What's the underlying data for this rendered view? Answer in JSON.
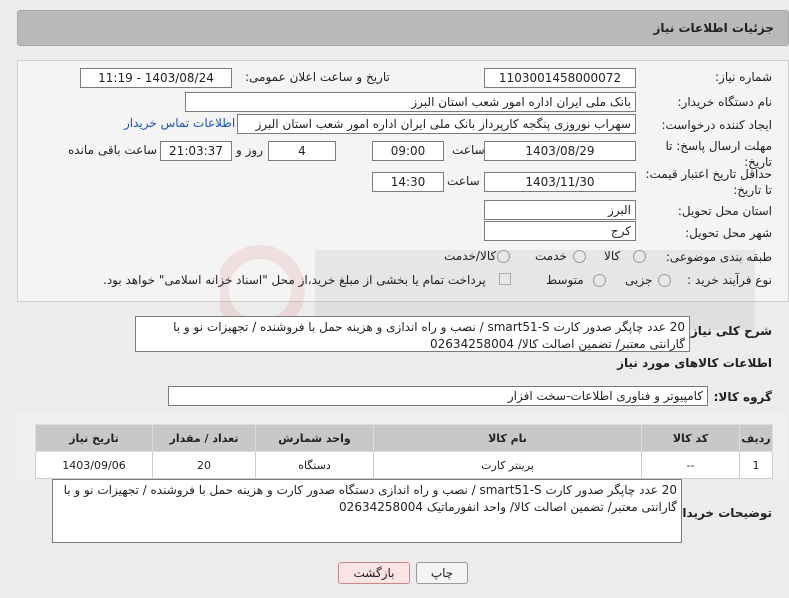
{
  "header": {
    "title": "جزئیات اطلاعات نیاز"
  },
  "form": {
    "need_number_label": "شماره نیاز:",
    "need_number": "1103001458000072",
    "announce_label": "تاریخ و ساعت اعلان عمومی:",
    "announce_value": "1403/08/24 - 11:19",
    "buyer_org_label": "نام دستگاه خریدار:",
    "buyer_org": "بانک ملی ایران اداره امور شعب استان البرز",
    "creator_label": "ایجاد کننده درخواست:",
    "creator": "سهراب نوروزی پنگجه کارپرداز بانک ملی ایران اداره امور شعب استان البرز",
    "contact_link": "اطلاعات تماس خریدار",
    "reply_deadline_label": "مهلت ارسال پاسخ: تا تاریخ:",
    "reply_date": "1403/08/29",
    "time_label": "ساعت",
    "reply_time": "09:00",
    "days_value": "4",
    "days_label": "روز و",
    "remaining_time": "21:03:37",
    "remaining_label": "ساعت باقی مانده",
    "price_validity_label": "حداقل تاریخ اعتبار قیمت: تا تاریخ:",
    "validity_date": "1403/11/30",
    "validity_time": "14:30",
    "province_label": "استان محل تحویل:",
    "province": "البرز",
    "city_label": "شهر محل تحویل:",
    "city": "کرج",
    "category_label": "طبقه بندی موضوعی:",
    "category_options": [
      "کالا",
      "خدمت",
      "کالا/خدمت"
    ],
    "process_label": "نوع فرآیند خرید :",
    "process_options": [
      "جزیی",
      "متوسط"
    ],
    "payment_note": "پرداخت تمام یا بخشی از مبلغ خرید،از محل \"اسناد خزانه اسلامی\" خواهد بود."
  },
  "need_summary": {
    "label": "شرح کلی نیاز:",
    "text": "20 عدد چاپگر صدور کارت smart51-S / نصب و راه اندازی و هزینه حمل با فروشنده / تجهیزات نو و با گارانتی معتبر/ تضمین اصالت کالا/ 02634258004"
  },
  "goods_info": {
    "title": "اطلاعات کالاهای مورد نیاز",
    "group_label": "گروه کالا:",
    "group_value": "کامپیوتر و فناوری اطلاعات-سخت افزار",
    "columns": [
      "ردیف",
      "کد کالا",
      "نام کالا",
      "واحد شمارش",
      "تعداد / مقدار",
      "تاریخ نیاز"
    ],
    "rows": [
      [
        "1",
        "--",
        "پرینتر کارت",
        "دستگاه",
        "20",
        "1403/09/06"
      ]
    ]
  },
  "buyer_notes": {
    "label": "توضیحات خریدار:",
    "text": "20 عدد چاپگر صدور کارت smart51-S / نصب و راه اندازی دستگاه صدور کارت و هزینه حمل با فروشنده / تجهیزات نو و با گارانتی معتبر/ تضمین اصالت کالا/ واحد انفورماتیک 02634258004"
  },
  "buttons": {
    "print": "چاپ",
    "back": "بازگشت"
  },
  "colors": {
    "link": "#1a56b8",
    "back_button_bg": "#fde4e4",
    "back_button_border": "#c88"
  }
}
